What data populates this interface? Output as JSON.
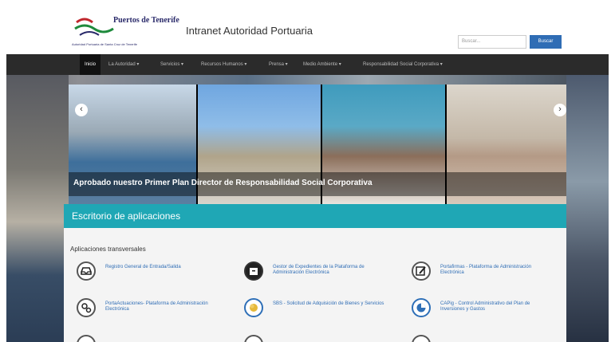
{
  "header": {
    "logo_name": "Puertos de Tenerife",
    "logo_sub": "Autoridad Portuaria de Santa Cruz de Tenerife",
    "site_title": "Intranet Autoridad Portuaria",
    "search_placeholder": "Buscar...",
    "search_button": "Buscar"
  },
  "nav": {
    "items": [
      {
        "label": "Inicio"
      },
      {
        "label": "La Autoridad"
      },
      {
        "label": "Servicios"
      },
      {
        "label": "Recursos Humanos"
      },
      {
        "label": "Prensa"
      },
      {
        "label": "Medio Ambiente"
      },
      {
        "label": "Responsabilidad Social Corporativa"
      }
    ]
  },
  "carousel": {
    "caption": "Aprobado nuestro Primer Plan Director de Responsabilidad Social Corporativa",
    "prev_icon": "chevron-left-icon",
    "next_icon": "chevron-right-icon"
  },
  "desk": {
    "title": "Escritorio de aplicaciones",
    "section": "Aplicaciones transversales",
    "apps": [
      {
        "label": "Registro General de Entrada/Salida",
        "icon": "inbox-icon"
      },
      {
        "label": "Gestor de Expedientes de la Plataforma de Administración Electrónica",
        "icon": "archive-box-icon"
      },
      {
        "label": "Portafirmas - Plataforma de Administración Electrónica",
        "icon": "pen-sign-icon"
      },
      {
        "label": "PortaActuaciones- Plataforma de Administración Electrónica",
        "icon": "gears-icon"
      },
      {
        "label": "SBS - Solicitud de Adquisición de Bienes y Servicios",
        "icon": "coins-icon"
      },
      {
        "label": "CAPig - Control Administrativo del Plan de Inversiones y Gastos",
        "icon": "chart-icon"
      }
    ]
  },
  "colors": {
    "accent": "#1fa7b5",
    "nav_bg": "#2b2b2b",
    "link": "#2f6db5"
  }
}
